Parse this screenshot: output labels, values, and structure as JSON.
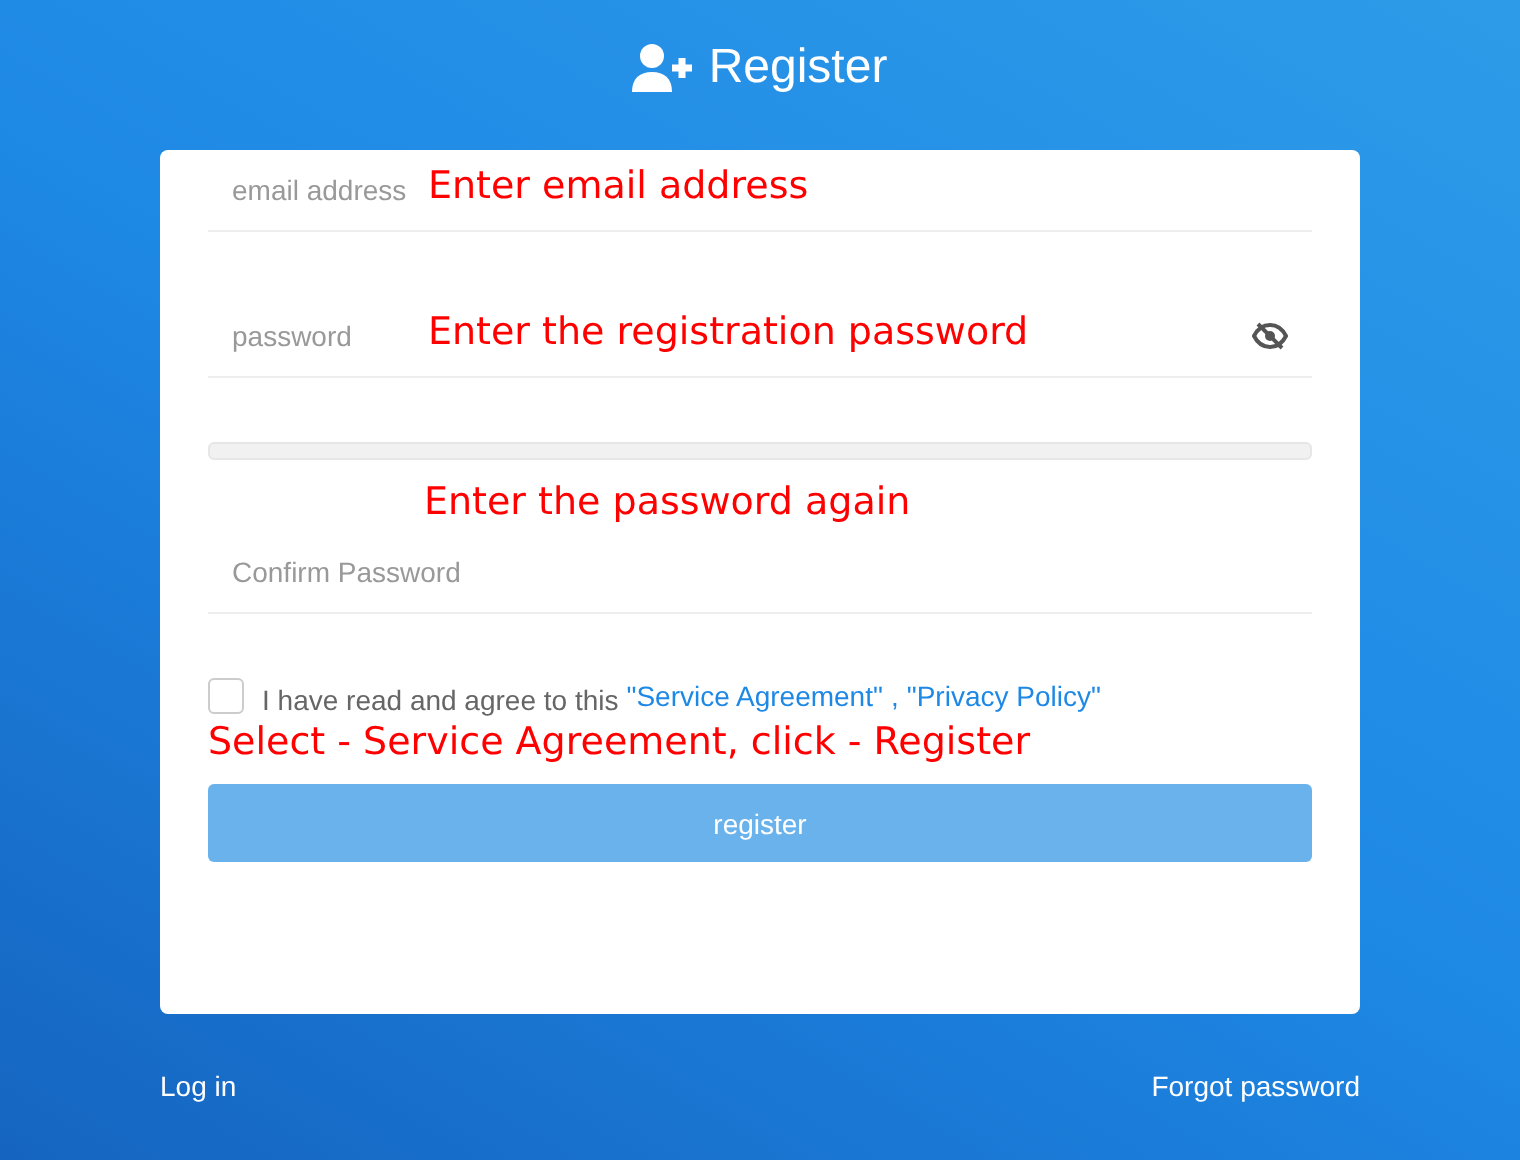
{
  "header": {
    "title": "Register"
  },
  "form": {
    "email": {
      "placeholder": "email address",
      "annotation": "Enter email address"
    },
    "password": {
      "placeholder": "password",
      "annotation": "Enter the registration password",
      "visible": false
    },
    "confirm_annotation": "Enter the password again",
    "confirm": {
      "placeholder": "Confirm Password"
    },
    "agreement": {
      "checked": false,
      "text": "I have read and agree to this",
      "links": [
        "\"Service Agreement\"",
        "\"Privacy Policy\""
      ],
      "separator": ","
    },
    "agreement_annotation": "Select - Service Agreement, click - Register",
    "submit": {
      "label": "register",
      "disabled": true
    }
  },
  "footer": {
    "left_link": "Log in",
    "right_link": "Forgot password"
  }
}
